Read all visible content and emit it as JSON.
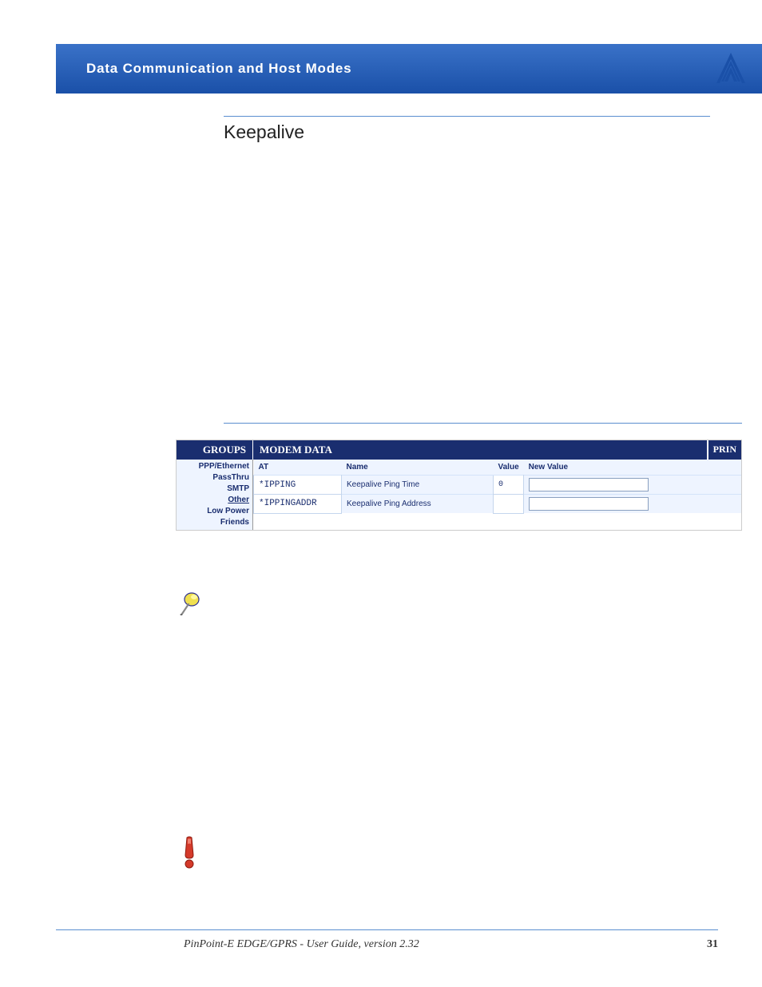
{
  "banner": {
    "title": "Data Communication  and Host Modes"
  },
  "section": {
    "title": "Keepalive"
  },
  "config": {
    "groups_header": "GROUPS",
    "modem_header": "MODEM DATA",
    "prin": "PRIN",
    "sidebar": {
      "ppp": "PPP/Ethernet",
      "passthru": "PassThru",
      "smtp": "SMTP",
      "other": "Other",
      "lowpower": "Low Power",
      "friends": "Friends"
    },
    "columns": {
      "at": "AT",
      "name": "Name",
      "value": "Value",
      "newvalue": "New Value"
    },
    "rows": [
      {
        "at": "*IPPING",
        "name": "Keepalive Ping Time",
        "value": "0"
      },
      {
        "at": "*IPPINGADDR",
        "name": "Keepalive Ping Address",
        "value": ""
      }
    ]
  },
  "footer": {
    "text": "PinPoint-E EDGE/GPRS - User Guide, version 2.32",
    "page": "31"
  }
}
